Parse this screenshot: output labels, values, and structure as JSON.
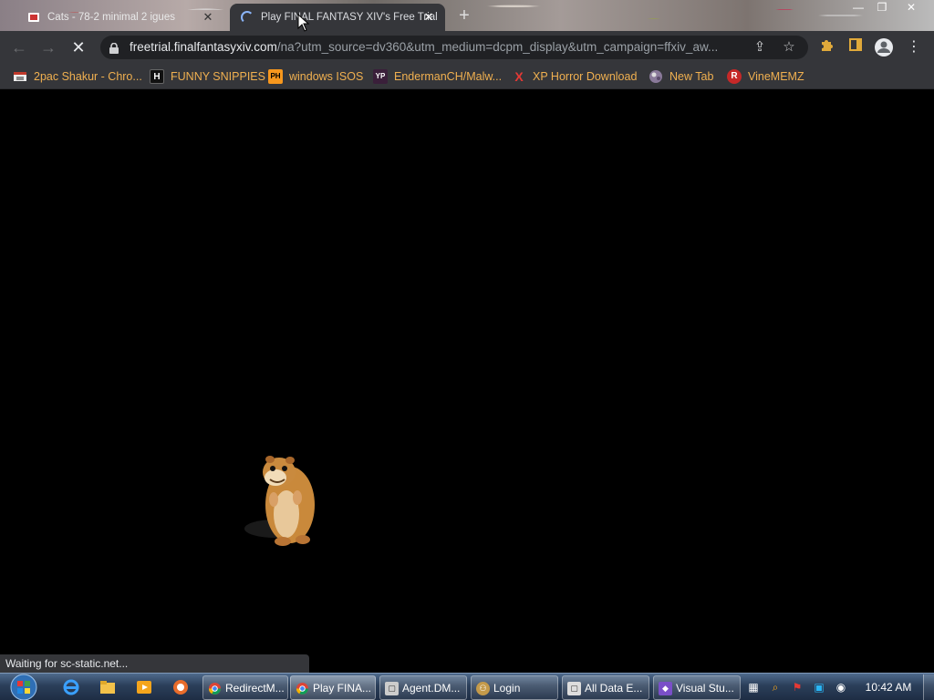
{
  "tabs": [
    {
      "title": "Cats - 78-2 minimal 2 igues",
      "active": false
    },
    {
      "title": "Play FINAL FANTASY XIV's Free Trial",
      "active": true
    }
  ],
  "window_controls": {
    "minimize": "—",
    "maximize": "❐",
    "close": "✕"
  },
  "toolbar": {
    "url_host": "freetrial.finalfantasyxiv.com",
    "url_rest": "/na?utm_source=dv360&utm_medium=dcpm_display&utm_campaign=ffxiv_aw..."
  },
  "bookmarks": [
    {
      "label": "2pac Shakur - Chro...",
      "icon": "image-icon",
      "color": "#c0392b"
    },
    {
      "label": "FUNNY SNIPPIES",
      "icon": "H",
      "color": "#111111"
    },
    {
      "label": "windows ISOS",
      "icon": "PH",
      "color": "#f7971d"
    },
    {
      "label": "EndermanCH/Malw...",
      "icon": "YP",
      "color": "#3a1f3a"
    },
    {
      "label": "XP Horror Download",
      "icon": "X",
      "color": "#d32f2f"
    },
    {
      "label": "New Tab",
      "icon": "globe-icon",
      "color": "#7a6a8a"
    },
    {
      "label": "VineMEMZ",
      "icon": "R",
      "color": "#c62828"
    }
  ],
  "status": "Waiting for sc-static.net...",
  "taskbar": {
    "tasks": [
      {
        "label": "RedirectM...",
        "active": false
      },
      {
        "label": "Play FINA...",
        "active": true
      },
      {
        "label": "Agent.DM...",
        "active": false
      },
      {
        "label": "Login",
        "active": false
      },
      {
        "label": "All Data E...",
        "active": false
      },
      {
        "label": "Visual Stu...",
        "active": false
      }
    ],
    "clock": "10:42 AM"
  },
  "colors": {
    "chrome_dark": "#35363a",
    "omnibox": "#202124",
    "bookmark_text": "#f0b050",
    "page_bg": "#000000"
  }
}
